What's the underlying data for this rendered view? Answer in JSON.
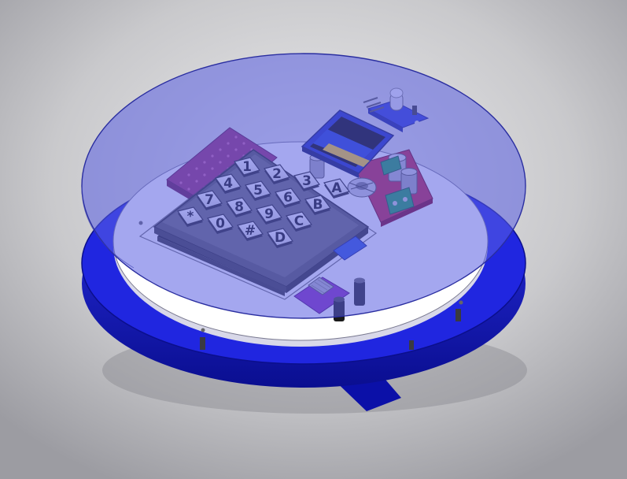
{
  "keypad": {
    "rows": [
      [
        "1",
        "2",
        "3",
        "A"
      ],
      [
        "4",
        "5",
        "6",
        "B"
      ],
      [
        "7",
        "8",
        "9",
        "C"
      ],
      [
        "*",
        "0",
        "#",
        "D"
      ]
    ]
  },
  "colors": {
    "base": "#1a20d8",
    "base_dark": "#0c10a0",
    "lid_glass": "#6e72e6",
    "platform": "#ffffff",
    "protoboard": "#9a2a6c",
    "pcb_red": "#c02040",
    "oled_blue": "#1f3fd0",
    "oled_yellow": "#ffd21a",
    "lcd_green": "#22b048",
    "keypad_body": "#6c6c6c",
    "key_face": "#f4f4f4"
  },
  "icons": [
    "keypad-icon",
    "oled-display-icon",
    "led-sensor-icon",
    "capacitor-icon",
    "inductor-coil-icon",
    "terminal-block-icon"
  ]
}
